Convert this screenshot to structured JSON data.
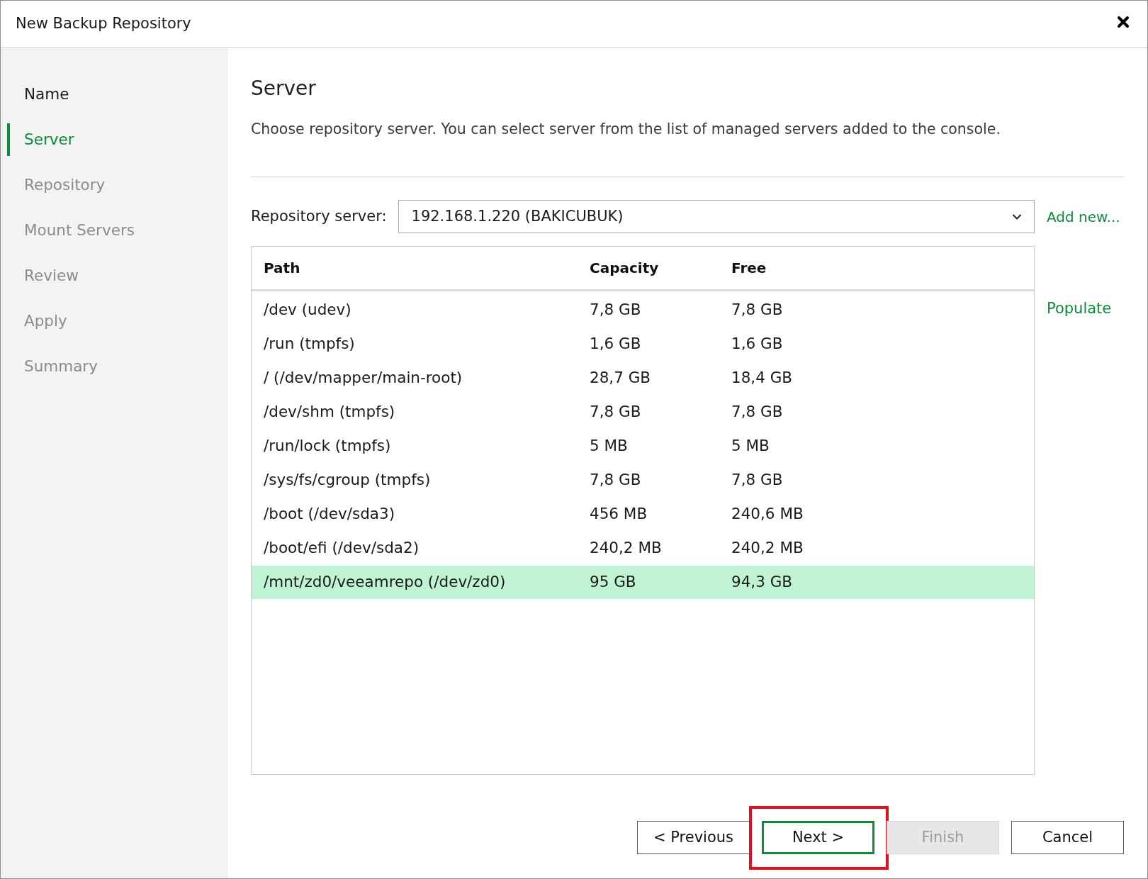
{
  "window": {
    "title": "New Backup Repository"
  },
  "steps": [
    {
      "label": "Name",
      "selected": false,
      "disabled": false
    },
    {
      "label": "Server",
      "selected": true,
      "disabled": false
    },
    {
      "label": "Repository",
      "selected": false,
      "disabled": true
    },
    {
      "label": "Mount Servers",
      "selected": false,
      "disabled": true
    },
    {
      "label": "Review",
      "selected": false,
      "disabled": true
    },
    {
      "label": "Apply",
      "selected": false,
      "disabled": true
    },
    {
      "label": "Summary",
      "selected": false,
      "disabled": true
    }
  ],
  "page": {
    "heading": "Server",
    "description": "Choose repository server. You can select server from the list of managed servers added to the console."
  },
  "server_field": {
    "label": "Repository server:",
    "value": "192.168.1.220 (BAKICUBUK)",
    "link": "Add new..."
  },
  "table": {
    "columns": [
      "Path",
      "Capacity",
      "Free"
    ],
    "rows": [
      {
        "cells": [
          "/dev (udev)",
          "7,8 GB",
          "7,8 GB"
        ],
        "selected": false
      },
      {
        "cells": [
          "/run (tmpfs)",
          "1,6 GB",
          "1,6 GB"
        ],
        "selected": false
      },
      {
        "cells": [
          "/ (/dev/mapper/main-root)",
          "28,7 GB",
          "18,4 GB"
        ],
        "selected": false
      },
      {
        "cells": [
          "/dev/shm (tmpfs)",
          "7,8 GB",
          "7,8 GB"
        ],
        "selected": false
      },
      {
        "cells": [
          "/run/lock (tmpfs)",
          "5 MB",
          "5 MB"
        ],
        "selected": false
      },
      {
        "cells": [
          "/sys/fs/cgroup (tmpfs)",
          "7,8 GB",
          "7,8 GB"
        ],
        "selected": false
      },
      {
        "cells": [
          "/boot (/dev/sda3)",
          "456 MB",
          "240,6 MB"
        ],
        "selected": false
      },
      {
        "cells": [
          "/boot/efi (/dev/sda2)",
          "240,2 MB",
          "240,2 MB"
        ],
        "selected": false
      },
      {
        "cells": [
          "/mnt/zd0/veeamrepo (/dev/zd0)",
          "95 GB",
          "94,3 GB"
        ],
        "selected": true
      }
    ]
  },
  "populate_link": "Populate",
  "buttons": [
    {
      "label": "< Previous",
      "default": false,
      "disabled": false,
      "highlighted": false
    },
    {
      "label": "Next >",
      "default": true,
      "disabled": false,
      "highlighted": true
    },
    {
      "label": "Finish",
      "default": false,
      "disabled": true,
      "highlighted": false
    },
    {
      "label": "Cancel",
      "default": false,
      "disabled": false,
      "highlighted": false
    }
  ]
}
